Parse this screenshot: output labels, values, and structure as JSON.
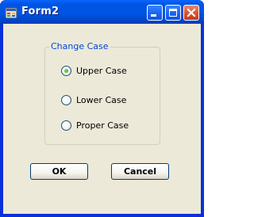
{
  "window": {
    "title": "Form2",
    "controls": [
      "minimize-icon",
      "maximize-icon",
      "close-icon"
    ]
  },
  "groupbox": {
    "label": "Change Case",
    "options": [
      {
        "label": "Upper Case",
        "checked": true
      },
      {
        "label": "Lower Case",
        "checked": false
      },
      {
        "label": "Proper Case",
        "checked": false
      }
    ]
  },
  "buttons": {
    "ok_label": "OK",
    "cancel_label": "Cancel"
  },
  "colors": {
    "titlebar": "#0054e3",
    "client_background": "#ece9d8",
    "group_label": "#0046d5",
    "close_button": "#de5533"
  }
}
